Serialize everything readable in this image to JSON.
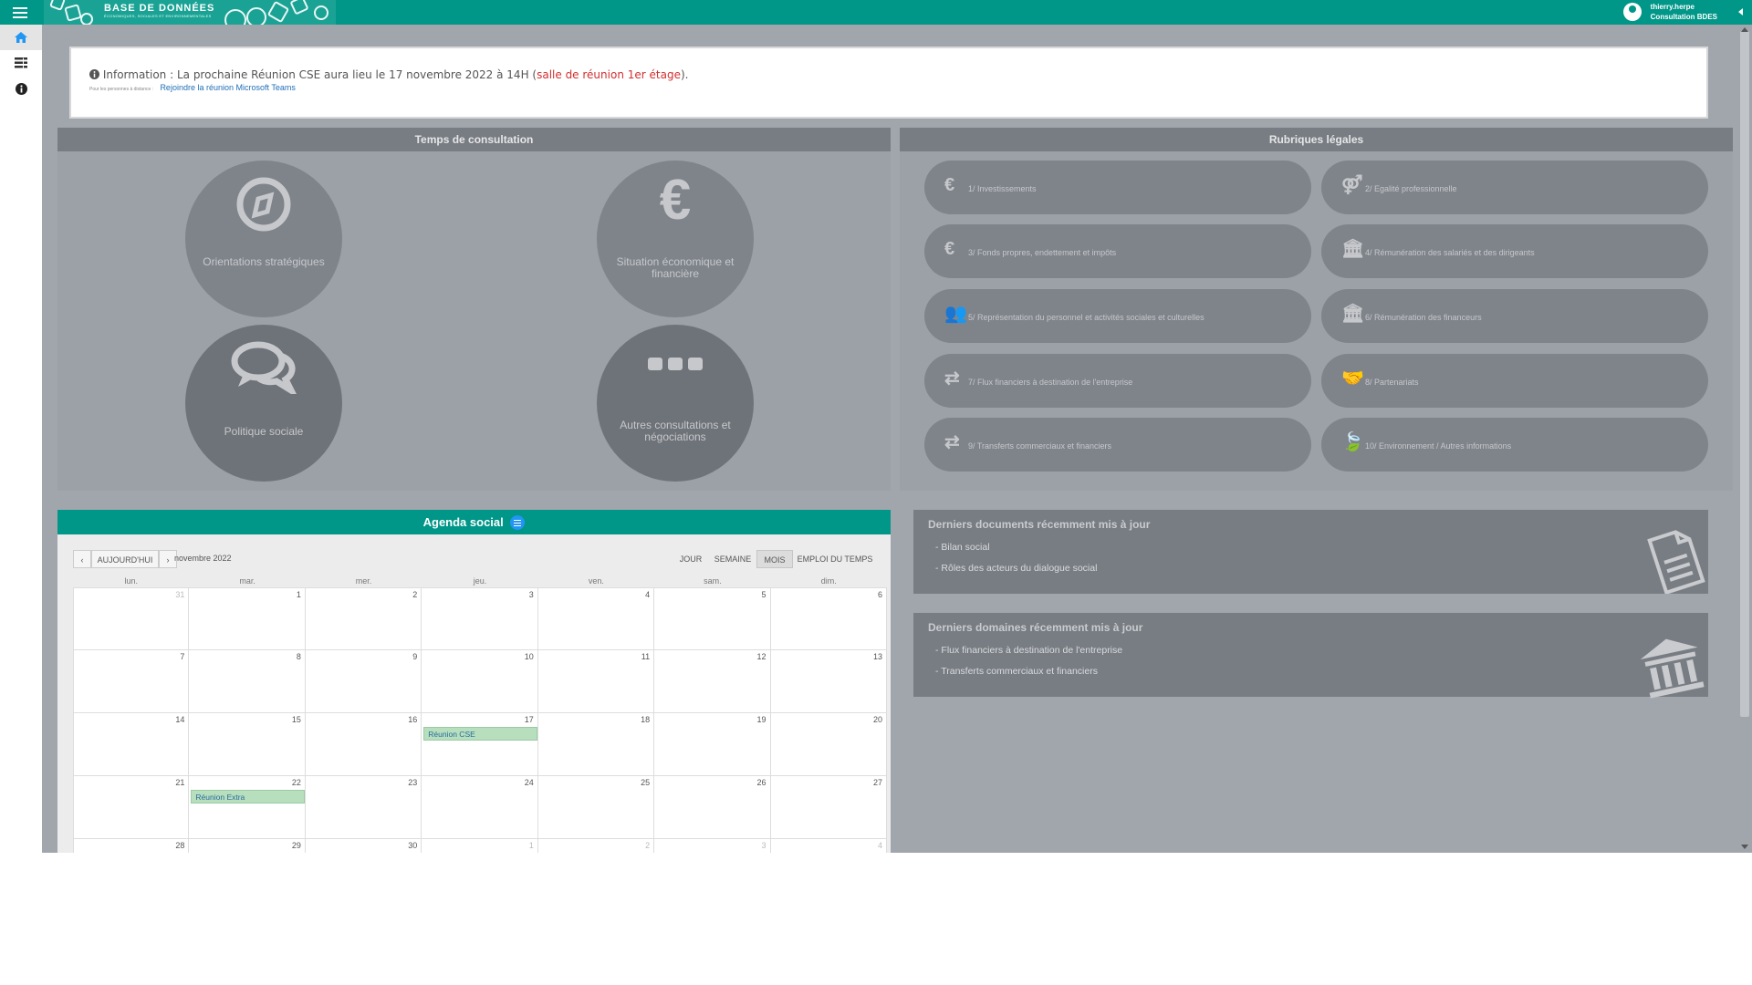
{
  "app": {
    "logo_title": "BASE DE DONNÉES",
    "logo_subtitle": "ÉCONOMIQUES, SOCIALES ET ENVIRONNEMENTALES",
    "brand_color": "#009688"
  },
  "user": {
    "name": "thierry.herpe",
    "role": "Consultation BDES"
  },
  "sidenav": [
    {
      "icon": "home-icon"
    },
    {
      "icon": "list-icon"
    },
    {
      "icon": "info-icon"
    }
  ],
  "info": {
    "prefix": "Information : La prochaine Réunion CSE aura lieu le 17 novembre 2022 à 14H (",
    "highlight": "salle de réunion 1er étage",
    "suffix": ").",
    "remote_label": "Pour les personnes à distance :",
    "teams_link": "Rejoindre la réunion Microsoft Teams"
  },
  "consultation": {
    "title": "Temps de consultation",
    "items": [
      {
        "label": "Orientations stratégiques",
        "icon": "compass-icon"
      },
      {
        "label": "Situation économique et financière",
        "icon": "euro-icon"
      },
      {
        "label": "Politique sociale",
        "icon": "comments-icon"
      },
      {
        "label": "Autres consultations et négociations",
        "icon": "ellipsis-icon"
      }
    ]
  },
  "rubriques": {
    "title": "Rubriques légales",
    "items": [
      {
        "label": "1/ Investissements",
        "icon": "€"
      },
      {
        "label": "2/ Egalité professionnelle",
        "icon": "⚤"
      },
      {
        "label": "3/ Fonds propres, endettement et impôts",
        "icon": "€"
      },
      {
        "label": "4/ Rémunération des salariés et des dirigeants",
        "icon": "🏛"
      },
      {
        "label": "5/ Représentation du personnel et activités sociales et culturelles",
        "icon": "👥"
      },
      {
        "label": "6/ Rémunération des financeurs",
        "icon": "🏛"
      },
      {
        "label": "7/ Flux financiers à destination de l'entreprise",
        "icon": "⇄"
      },
      {
        "label": "8/ Partenariats",
        "icon": "🤝"
      },
      {
        "label": "9/ Transferts commerciaux et financiers",
        "icon": "⇄"
      },
      {
        "label": "10/ Environnement / Autres informations",
        "icon": "🍃"
      }
    ]
  },
  "agenda": {
    "title": "Agenda social",
    "today_label": "AUJOURD'HUI",
    "month_label": "novembre 2022",
    "views": [
      "JOUR",
      "SEMAINE",
      "MOIS",
      "EMPLOI DU TEMPS"
    ],
    "active_view": "MOIS",
    "days_of_week": [
      "lun.",
      "mar.",
      "mer.",
      "jeu.",
      "ven.",
      "sam.",
      "dim."
    ],
    "weeks": [
      [
        "31",
        "1",
        "2",
        "3",
        "4",
        "5",
        "6"
      ],
      [
        "7",
        "8",
        "9",
        "10",
        "11",
        "12",
        "13"
      ],
      [
        "14",
        "15",
        "16",
        "17",
        "18",
        "19",
        "20"
      ],
      [
        "21",
        "22",
        "23",
        "24",
        "25",
        "26",
        "27"
      ],
      [
        "28",
        "29",
        "30",
        "1",
        "2",
        "3",
        "4"
      ]
    ],
    "events": [
      {
        "week": 2,
        "day": 3,
        "title": "Réunion CSE"
      },
      {
        "week": 3,
        "day": 1,
        "title": "Réunion Extra"
      }
    ]
  },
  "recent_documents": {
    "title": "Derniers documents récemment mis à jour",
    "items": [
      "- Bilan social",
      "- Rôles des acteurs du dialogue social"
    ]
  },
  "recent_domains": {
    "title": "Derniers domaines récemment mis à jour",
    "items": [
      "- Flux financiers à destination de l'entreprise",
      "- Transferts commerciaux et financiers"
    ]
  }
}
